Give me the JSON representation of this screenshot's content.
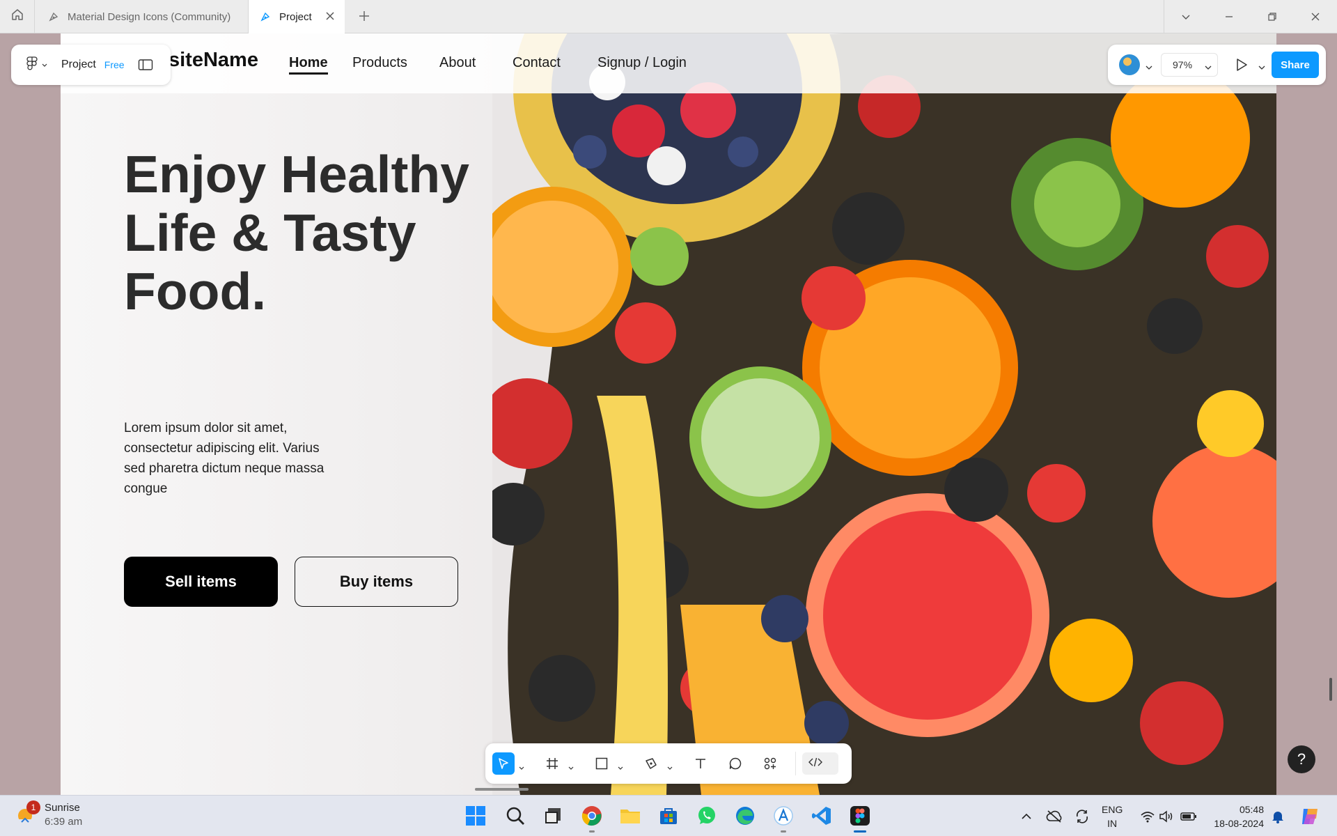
{
  "browser": {
    "tabs": [
      {
        "label": "Material Design Icons (Community)"
      },
      {
        "label": "Project"
      }
    ]
  },
  "site": {
    "logo": "siteName",
    "nav": [
      "Home",
      "Products",
      "About",
      "Contact",
      "Signup / Login"
    ],
    "hero_title": "Enjoy Healthy Life & Tasty Food.",
    "hero_text": "Lorem ipsum dolor sit amet, consectetur adipiscing elit. Varius sed pharetra dictum neque massa congue",
    "sell_button": "Sell items",
    "buy_button": "Buy items"
  },
  "figma": {
    "project_name": "Project",
    "plan_badge": "Free",
    "zoom": "97%",
    "share_label": "Share",
    "accent_color": "#0d99ff",
    "help_label": "?"
  },
  "taskbar": {
    "weather_title": "Sunrise",
    "weather_time": "6:39 am",
    "notification_count": "1",
    "language": "ENG",
    "region": "IN",
    "time": "05:48",
    "date": "18-08-2024"
  }
}
